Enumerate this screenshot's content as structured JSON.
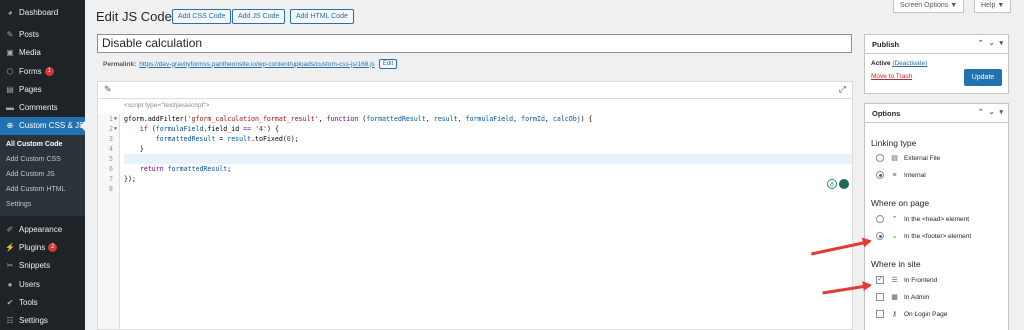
{
  "sidebar": {
    "items": [
      {
        "label": "Dashboard",
        "icon": "dashboard-icon"
      },
      {
        "label": "Posts",
        "icon": "pin-icon"
      },
      {
        "label": "Media",
        "icon": "media-icon"
      },
      {
        "label": "Forms",
        "icon": "forms-icon",
        "badge": "1"
      },
      {
        "label": "Pages",
        "icon": "pages-icon"
      },
      {
        "label": "Comments",
        "icon": "comments-icon"
      },
      {
        "label": "Custom CSS & JS",
        "icon": "plus-icon"
      }
    ],
    "submenu": [
      "All Custom Code",
      "Add Custom CSS",
      "Add Custom JS",
      "Add Custom HTML",
      "Settings"
    ],
    "items_after": [
      {
        "label": "Appearance",
        "icon": "brush-icon"
      },
      {
        "label": "Plugins",
        "icon": "plugin-icon",
        "badge": "2"
      },
      {
        "label": "Snippets",
        "icon": "scissors-icon"
      },
      {
        "label": "Users",
        "icon": "user-icon"
      },
      {
        "label": "Tools",
        "icon": "wrench-icon"
      },
      {
        "label": "Settings",
        "icon": "settings-icon"
      }
    ]
  },
  "header": {
    "title": "Edit JS Code",
    "buttons": [
      "Add CSS Code",
      "Add JS Code",
      "Add HTML Code"
    ],
    "screen_options": "Screen Options ▼",
    "help": "Help ▼"
  },
  "post": {
    "title": "Disable calculation",
    "permalink_label": "Permalink:",
    "permalink_url": "https://dev-gravityformss.pantheonsite.io/wp-content/uploads/custom-css-js/168.js",
    "edit_label": "Edit"
  },
  "editor": {
    "script_tag": "<script type=\"text/javascript\">",
    "line_numbers": [
      "1",
      "2",
      "3",
      "4",
      "5",
      "6",
      "7",
      "8"
    ]
  },
  "publish": {
    "title": "Publish",
    "status_label": "Active",
    "deactivate": "(Deactivate)",
    "trash": "Move to Trash",
    "update": "Update"
  },
  "options": {
    "title": "Options",
    "linking_type": {
      "title": "Linking type",
      "items": [
        "External File",
        "Internal"
      ],
      "selected": "Internal"
    },
    "where_on_page": {
      "title": "Where on page",
      "items": [
        "In the <head> element",
        "In the <footer> element"
      ],
      "selected": "In the <footer> element"
    },
    "where_in_site": {
      "title": "Where in site",
      "items": [
        "In Frontend",
        "In Admin",
        "On Login Page"
      ],
      "checked": [
        "In Frontend"
      ]
    }
  },
  "colors": {
    "accent": "#2271b1",
    "sidebar": "#1d2327",
    "annotation_arrow": "#e53935"
  }
}
